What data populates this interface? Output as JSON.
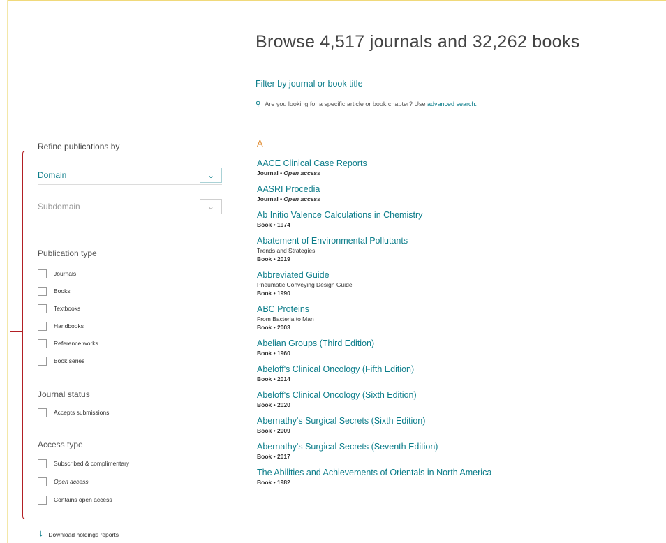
{
  "header": {
    "title": "Browse 4,517 journals and 32,262 books"
  },
  "filter": {
    "placeholder": "Filter by journal or book title",
    "hint_text": "Are you looking for a specific article or book chapter? Use",
    "hint_link": "advanced search."
  },
  "sidebar": {
    "refine_title": "Refine publications by",
    "domain_label": "Domain",
    "subdomain_label": "Subdomain",
    "publication_type": {
      "title": "Publication type",
      "options": [
        "Journals",
        "Books",
        "Textbooks",
        "Handbooks",
        "Reference works",
        "Book series"
      ]
    },
    "journal_status": {
      "title": "Journal status",
      "options": [
        "Accepts submissions"
      ]
    },
    "access_type": {
      "title": "Access type",
      "options": [
        "Subscribed & complimentary",
        "Open access",
        "Contains open access"
      ]
    },
    "download_label": "Download holdings reports"
  },
  "list": {
    "letter": "A",
    "items": [
      {
        "title": "AACE Clinical Case Reports",
        "type": "Journal",
        "detail": "Open access",
        "subtitle": ""
      },
      {
        "title": "AASRI Procedia",
        "type": "Journal",
        "detail": "Open access",
        "subtitle": ""
      },
      {
        "title": "Ab Initio Valence Calculations in Chemistry",
        "type": "Book",
        "detail": "1974",
        "subtitle": ""
      },
      {
        "title": "Abatement of Environmental Pollutants",
        "type": "Book",
        "detail": "2019",
        "subtitle": "Trends and Strategies"
      },
      {
        "title": "Abbreviated Guide",
        "type": "Book",
        "detail": "1990",
        "subtitle": "Pneumatic Conveying Design Guide"
      },
      {
        "title": "ABC Proteins",
        "type": "Book",
        "detail": "2003",
        "subtitle": "From Bacteria to Man"
      },
      {
        "title": "Abelian Groups (Third Edition)",
        "type": "Book",
        "detail": "1960",
        "subtitle": ""
      },
      {
        "title": "Abeloff's Clinical Oncology (Fifth Edition)",
        "type": "Book",
        "detail": "2014",
        "subtitle": ""
      },
      {
        "title": "Abeloff's Clinical Oncology (Sixth Edition)",
        "type": "Book",
        "detail": "2020",
        "subtitle": ""
      },
      {
        "title": "Abernathy's Surgical Secrets (Sixth Edition)",
        "type": "Book",
        "detail": "2009",
        "subtitle": ""
      },
      {
        "title": "Abernathy's Surgical Secrets (Seventh Edition)",
        "type": "Book",
        "detail": "2017",
        "subtitle": ""
      },
      {
        "title": "The Abilities and Achievements of Orientals in North America",
        "type": "Book",
        "detail": "1982",
        "subtitle": ""
      }
    ]
  },
  "colors": {
    "accent": "#0c7d8a",
    "letter": "#e08a2e",
    "bracket": "#b21f24",
    "frame": "#f0d97a"
  },
  "icons": {
    "search": "search-icon",
    "chevron": "chevron-down-icon",
    "download": "download-icon"
  }
}
